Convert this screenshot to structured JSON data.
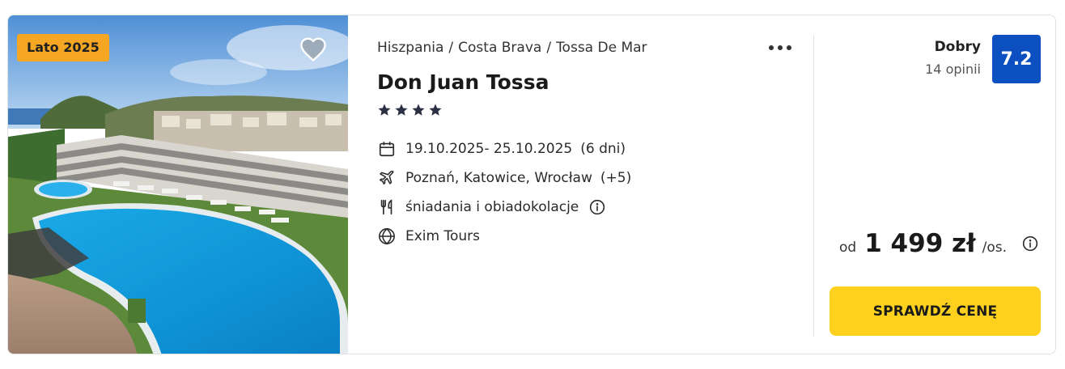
{
  "offer": {
    "season_badge": "Lato 2025",
    "breadcrumb": [
      "Hiszpania",
      "Costa Brava",
      "Tossa De Mar"
    ],
    "breadcrumb_separator": "/",
    "hotel_name": "Don Juan Tossa",
    "stars": 4,
    "dates": "19.10.2025- 25.10.2025",
    "duration": "(6 dni)",
    "departures": "Poznań, Katowice, Wrocław",
    "departures_more": "(+5)",
    "board": "śniadania i obiadokolacje",
    "operator": "Exim Tours",
    "rating_label": "Dobry",
    "rating_count": "14 opinii",
    "rating_score": "7.2",
    "price_prefix": "od",
    "price": "1 499 zł",
    "price_suffix": "/os.",
    "cta_label": "SPRAWDŹ CENĘ"
  },
  "icons": {
    "favorite": "heart-icon",
    "more": "more-dots-icon",
    "star": "star-icon",
    "dates": "calendar-icon",
    "departures": "plane-icon",
    "board": "fork-knife-icon",
    "operator": "globe-icon",
    "info": "info-icon"
  },
  "colors": {
    "badge_bg": "#f5a623",
    "rating_bg": "#0b4fc0",
    "cta_bg": "#fdd11d",
    "star": "#2b3142"
  }
}
